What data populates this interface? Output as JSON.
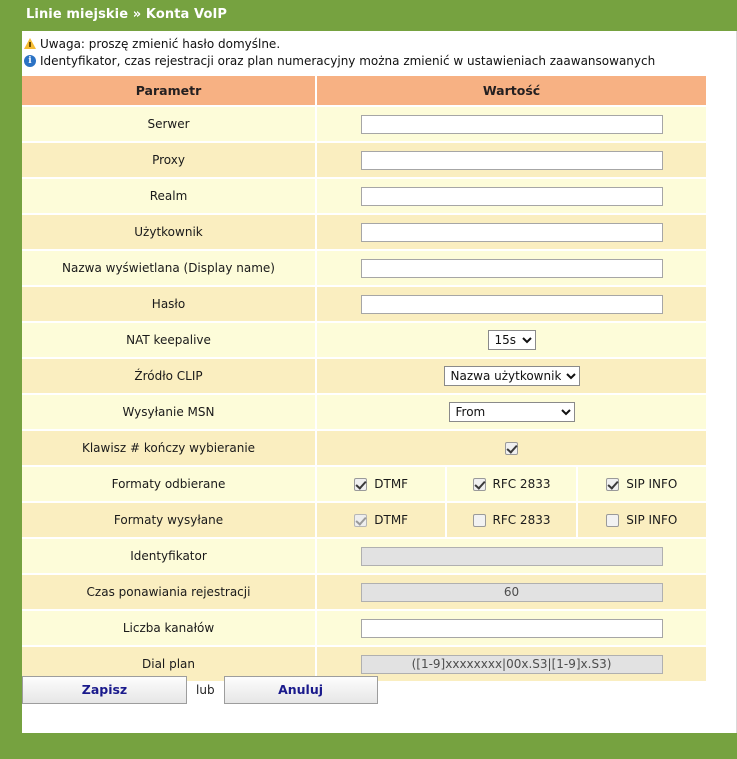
{
  "titlebar": {
    "text": "Linie miejskie » Konta VoIP"
  },
  "notices": [
    {
      "icon": "warning-triangle-icon",
      "glyph": "",
      "text": "Uwaga: proszę zmienić hasło domyślne."
    },
    {
      "icon": "info-circle-icon",
      "glyph": "i",
      "text": "Identyfikator, czas rejestracji oraz plan numeracyjny można zmienić w ustawieniach zaawansowanych"
    }
  ],
  "table": {
    "headers": {
      "param": "Parametr",
      "value": "Wartość"
    },
    "rows": {
      "serwer": {
        "label": "Serwer",
        "value": ""
      },
      "proxy": {
        "label": "Proxy",
        "value": ""
      },
      "realm": {
        "label": "Realm",
        "value": ""
      },
      "uzytkownik": {
        "label": "Użytkownik",
        "value": ""
      },
      "display_name": {
        "label": "Nazwa wyświetlana (Display name)",
        "value": ""
      },
      "haslo": {
        "label": "Hasło",
        "value": ""
      },
      "nat_keepalive": {
        "label": "NAT keepalive",
        "value": "15s"
      },
      "zrodlo_clip": {
        "label": "Źródło CLIP",
        "value": "Nazwa użytkownika"
      },
      "wysylanie_msn": {
        "label": "Wysyłanie MSN",
        "value": "From"
      },
      "hash_key": {
        "label": "Klawisz # kończy wybieranie",
        "checked": true
      },
      "formaty_odbierane": {
        "label": "Formaty odbierane",
        "options": [
          {
            "label": "DTMF",
            "checked": true
          },
          {
            "label": "RFC 2833",
            "checked": true
          },
          {
            "label": "SIP INFO",
            "checked": true
          }
        ]
      },
      "formaty_wysylane": {
        "label": "Formaty wysyłane",
        "options": [
          {
            "label": "DTMF",
            "checked": true
          },
          {
            "label": "RFC 2833",
            "checked": false
          },
          {
            "label": "SIP INFO",
            "checked": false
          }
        ]
      },
      "identyfikator": {
        "label": "Identyfikator",
        "value": ""
      },
      "czas_rejestracji": {
        "label": "Czas ponawiania rejestracji",
        "value": "60"
      },
      "liczba_kanalow": {
        "label": "Liczba kanałów",
        "value": ""
      },
      "dial_plan": {
        "label": "Dial plan",
        "value": "([1-9]xxxxxxxx|00x.S3|[1-9]x.S3)"
      }
    }
  },
  "footer": {
    "save_label": "Zapisz",
    "separator": "lub",
    "cancel_label": "Anuluj"
  },
  "colors": {
    "brand_green": "#76a240",
    "header_peach": "#f7b183",
    "row_light": "#fdfcd9",
    "row_dark": "#faeec0",
    "button_text": "#1a1a8c"
  }
}
